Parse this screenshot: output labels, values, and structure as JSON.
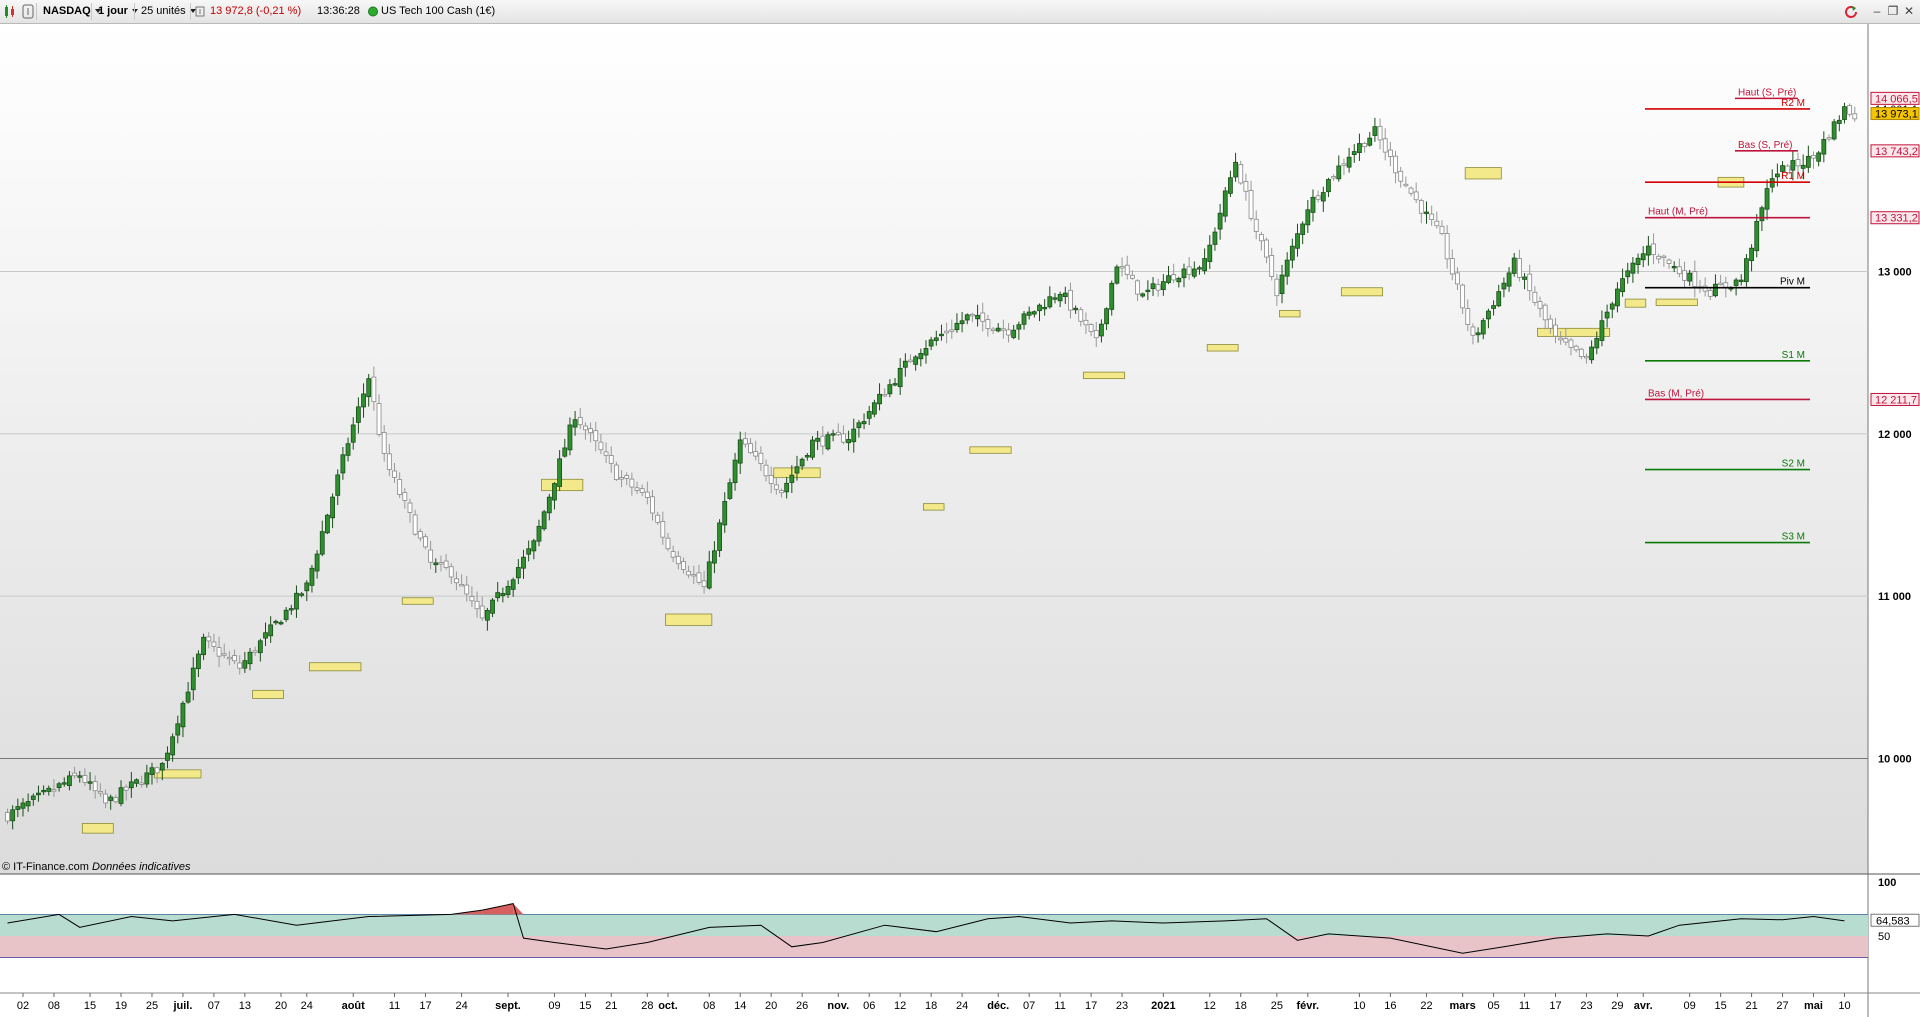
{
  "toolbar": {
    "symbol": "NASDAQ",
    "period": "1 jour",
    "units": "25 unités",
    "price_change": "13 972,8 (-0,21 %)",
    "time": "13:36:28",
    "instrument": "US Tech 100 Cash (1€)",
    "icons": [
      "chart-type-icon",
      "settings-icon",
      "info-icon",
      "status-dot-icon",
      "refresh-icon",
      "minimize-icon",
      "restore-icon",
      "close-icon"
    ],
    "colors": {
      "negative": "#c00000",
      "status_dot": "#2eaa2e"
    }
  },
  "copyright": {
    "left": "© IT-Finance.com",
    "right": "Données indicatives"
  },
  "chart_data": [
    {
      "type": "candlestick",
      "y_range": [
        9350,
        14500
      ],
      "y_ticks": [
        {
          "value": 10000,
          "label": "10 000"
        },
        {
          "value": 11000,
          "label": "11 000"
        },
        {
          "value": 12000,
          "label": "12 000"
        },
        {
          "value": 13000,
          "label": "13 000"
        }
      ],
      "price_labels": [
        {
          "value": 14066.5,
          "label": "14 066,5",
          "style": "red"
        },
        {
          "value": 14001.1,
          "label": "14 001,1",
          "style": "plain"
        },
        {
          "value": 13973.1,
          "label": "13 973,1",
          "style": "last"
        },
        {
          "value": 13743.2,
          "label": "13 743,2",
          "style": "red"
        },
        {
          "value": 13331.2,
          "label": "13 331,2",
          "style": "red"
        },
        {
          "value": 12211.7,
          "label": "12 211,7",
          "style": "red"
        }
      ],
      "trend": [
        [
          0,
          9650
        ],
        [
          14,
          9900
        ],
        [
          19,
          9720
        ],
        [
          30,
          9960
        ],
        [
          38,
          10720
        ],
        [
          45,
          10560
        ],
        [
          58,
          11060
        ],
        [
          66,
          11950
        ],
        [
          70,
          12350
        ],
        [
          73,
          11850
        ],
        [
          82,
          11200
        ],
        [
          86,
          11150
        ],
        [
          92,
          10850
        ],
        [
          102,
          11320
        ],
        [
          110,
          12120
        ],
        [
          118,
          11750
        ],
        [
          124,
          11600
        ],
        [
          128,
          11300
        ],
        [
          135,
          11050
        ],
        [
          142,
          11950
        ],
        [
          150,
          11650
        ],
        [
          156,
          11950
        ],
        [
          163,
          11980
        ],
        [
          176,
          12500
        ],
        [
          186,
          12720
        ],
        [
          194,
          12640
        ],
        [
          204,
          12880
        ],
        [
          211,
          12560
        ],
        [
          215,
          13050
        ],
        [
          220,
          12850
        ],
        [
          226,
          12980
        ],
        [
          232,
          13050
        ],
        [
          238,
          13680
        ],
        [
          242,
          13250
        ],
        [
          246,
          12880
        ],
        [
          252,
          13400
        ],
        [
          260,
          13720
        ],
        [
          265,
          13860
        ],
        [
          270,
          13580
        ],
        [
          278,
          13200
        ],
        [
          284,
          12580
        ],
        [
          292,
          13050
        ],
        [
          300,
          12580
        ],
        [
          306,
          12450
        ],
        [
          312,
          12900
        ],
        [
          318,
          13150
        ],
        [
          324,
          13000
        ],
        [
          330,
          12880
        ],
        [
          336,
          12950
        ],
        [
          342,
          13600
        ],
        [
          350,
          13700
        ],
        [
          356,
          14000
        ],
        [
          358,
          13973
        ]
      ],
      "levels": [
        {
          "name": "Haut (S, Pré)",
          "value": 14066.5,
          "color": "#c0143c",
          "scope": "week"
        },
        {
          "name": "R2 M",
          "value": 14001.1,
          "color": "#d40000",
          "scope": "month"
        },
        {
          "name": "Bas (S, Pré)",
          "value": 13743.2,
          "color": "#c0143c",
          "scope": "week"
        },
        {
          "name": "R1 M",
          "value": 13550,
          "color": "#d40000",
          "scope": "month"
        },
        {
          "name": "Haut (M, Pré)",
          "value": 13331.2,
          "color": "#c0143c",
          "scope": "month"
        },
        {
          "name": "Piv M",
          "value": 12900,
          "color": "#000000",
          "scope": "month"
        },
        {
          "name": "S1 M",
          "value": 12450,
          "color": "#0a7a0a",
          "scope": "month"
        },
        {
          "name": "Bas (M, Pré)",
          "value": 12211.7,
          "color": "#c0143c",
          "scope": "month"
        },
        {
          "name": "S2 M",
          "value": 11780,
          "color": "#0a7a0a",
          "scope": "month"
        },
        {
          "name": "S3 M",
          "value": 11330,
          "color": "#0a7a0a",
          "scope": "month"
        }
      ],
      "gap_boxes": [
        {
          "x0": 14.5,
          "x1": 20.5,
          "low": 9540,
          "high": 9600
        },
        {
          "x0": 28.5,
          "x1": 37.5,
          "low": 9880,
          "high": 9930
        },
        {
          "x0": 47.5,
          "x1": 53.5,
          "low": 10370,
          "high": 10420
        },
        {
          "x0": 58.5,
          "x1": 68.5,
          "low": 10540,
          "high": 10590
        },
        {
          "x0": 76.5,
          "x1": 82.5,
          "low": 10950,
          "high": 10990
        },
        {
          "x0": 103.5,
          "x1": 111.5,
          "low": 11650,
          "high": 11720
        },
        {
          "x0": 127.5,
          "x1": 136.5,
          "low": 10820,
          "high": 10890
        },
        {
          "x0": 148.5,
          "x1": 157.5,
          "low": 11730,
          "high": 11790
        },
        {
          "x0": 177.5,
          "x1": 181.5,
          "low": 11530,
          "high": 11570
        },
        {
          "x0": 186.5,
          "x1": 194.5,
          "low": 11880,
          "high": 11920
        },
        {
          "x0": 208.5,
          "x1": 216.5,
          "low": 12340,
          "high": 12380
        },
        {
          "x0": 232.5,
          "x1": 238.5,
          "low": 12510,
          "high": 12550
        },
        {
          "x0": 246.5,
          "x1": 250.5,
          "low": 12720,
          "high": 12760
        },
        {
          "x0": 258.5,
          "x1": 266.5,
          "low": 12850,
          "high": 12900
        },
        {
          "x0": 282.5,
          "x1": 289.5,
          "low": 13570,
          "high": 13640
        },
        {
          "x0": 296.5,
          "x1": 310.5,
          "low": 12600,
          "high": 12650
        },
        {
          "x0": 313.5,
          "x1": 317.5,
          "low": 12780,
          "high": 12830
        },
        {
          "x0": 319.5,
          "x1": 327.5,
          "low": 12790,
          "high": 12830
        },
        {
          "x0": 331.5,
          "x1": 336.5,
          "low": 13520,
          "high": 13580
        }
      ],
      "x_ticks": [
        {
          "i": 3,
          "label": "02",
          "major": false
        },
        {
          "i": 9,
          "label": "08",
          "major": false
        },
        {
          "i": 16,
          "label": "15",
          "major": false
        },
        {
          "i": 22,
          "label": "19",
          "major": false
        },
        {
          "i": 28,
          "label": "25",
          "major": false
        },
        {
          "i": 34,
          "label": "juil.",
          "major": true
        },
        {
          "i": 40,
          "label": "07",
          "major": false
        },
        {
          "i": 46,
          "label": "13",
          "major": false
        },
        {
          "i": 53,
          "label": "20",
          "major": false
        },
        {
          "i": 58,
          "label": "24",
          "major": false
        },
        {
          "i": 67,
          "label": "août",
          "major": true
        },
        {
          "i": 75,
          "label": "11",
          "major": false
        },
        {
          "i": 81,
          "label": "17",
          "major": false
        },
        {
          "i": 88,
          "label": "24",
          "major": false
        },
        {
          "i": 97,
          "label": "sept.",
          "major": true
        },
        {
          "i": 106,
          "label": "09",
          "major": false
        },
        {
          "i": 112,
          "label": "15",
          "major": false
        },
        {
          "i": 117,
          "label": "21",
          "major": false
        },
        {
          "i": 124,
          "label": "28",
          "major": false
        },
        {
          "i": 128,
          "label": "oct.",
          "major": true
        },
        {
          "i": 136,
          "label": "08",
          "major": false
        },
        {
          "i": 142,
          "label": "14",
          "major": false
        },
        {
          "i": 148,
          "label": "20",
          "major": false
        },
        {
          "i": 154,
          "label": "26",
          "major": false
        },
        {
          "i": 161,
          "label": "nov.",
          "major": true
        },
        {
          "i": 167,
          "label": "06",
          "major": false
        },
        {
          "i": 173,
          "label": "12",
          "major": false
        },
        {
          "i": 179,
          "label": "18",
          "major": false
        },
        {
          "i": 185,
          "label": "24",
          "major": false
        },
        {
          "i": 192,
          "label": "déc.",
          "major": true
        },
        {
          "i": 198,
          "label": "07",
          "major": false
        },
        {
          "i": 204,
          "label": "11",
          "major": false
        },
        {
          "i": 210,
          "label": "17",
          "major": false
        },
        {
          "i": 216,
          "label": "23",
          "major": false
        },
        {
          "i": 224,
          "label": "2021",
          "major": true
        },
        {
          "i": 233,
          "label": "12",
          "major": false
        },
        {
          "i": 239,
          "label": "18",
          "major": false
        },
        {
          "i": 246,
          "label": "25",
          "major": false
        },
        {
          "i": 252,
          "label": "févr.",
          "major": true
        },
        {
          "i": 262,
          "label": "10",
          "major": false
        },
        {
          "i": 268,
          "label": "16",
          "major": false
        },
        {
          "i": 275,
          "label": "22",
          "major": false
        },
        {
          "i": 282,
          "label": "mars",
          "major": true
        },
        {
          "i": 288,
          "label": "05",
          "major": false
        },
        {
          "i": 294,
          "label": "11",
          "major": false
        },
        {
          "i": 300,
          "label": "17",
          "major": false
        },
        {
          "i": 306,
          "label": "23",
          "major": false
        },
        {
          "i": 312,
          "label": "29",
          "major": false
        },
        {
          "i": 317,
          "label": "avr.",
          "major": true
        },
        {
          "i": 326,
          "label": "09",
          "major": false
        },
        {
          "i": 332,
          "label": "15",
          "major": false
        },
        {
          "i": 338,
          "label": "21",
          "major": false
        },
        {
          "i": 344,
          "label": "27",
          "major": false
        },
        {
          "i": 350,
          "label": "mai",
          "major": true
        },
        {
          "i": 356,
          "label": "10",
          "major": false
        }
      ]
    },
    {
      "type": "line",
      "name": "RSI",
      "y_range": [
        0,
        100
      ],
      "bands": {
        "upper": 70,
        "mid": 50,
        "lower": 30
      },
      "y_ticks": [
        {
          "value": 100,
          "label": "100"
        },
        {
          "value": 50,
          "label": "50"
        }
      ],
      "last_value": {
        "value": 64.583,
        "label": "64,583"
      },
      "points": [
        [
          0,
          62
        ],
        [
          10,
          70
        ],
        [
          14,
          58
        ],
        [
          24,
          68
        ],
        [
          32,
          64
        ],
        [
          44,
          70
        ],
        [
          56,
          60
        ],
        [
          70,
          68
        ],
        [
          86,
          70
        ],
        [
          92,
          74
        ],
        [
          98,
          80
        ],
        [
          100,
          48
        ],
        [
          106,
          44
        ],
        [
          116,
          38
        ],
        [
          124,
          44
        ],
        [
          136,
          58
        ],
        [
          146,
          60
        ],
        [
          152,
          40
        ],
        [
          158,
          44
        ],
        [
          170,
          60
        ],
        [
          180,
          54
        ],
        [
          190,
          66
        ],
        [
          196,
          68
        ],
        [
          206,
          62
        ],
        [
          214,
          64
        ],
        [
          224,
          62
        ],
        [
          236,
          64
        ],
        [
          244,
          66
        ],
        [
          250,
          46
        ],
        [
          256,
          52
        ],
        [
          268,
          48
        ],
        [
          276,
          40
        ],
        [
          282,
          34
        ],
        [
          290,
          40
        ],
        [
          300,
          48
        ],
        [
          310,
          52
        ],
        [
          318,
          50
        ],
        [
          324,
          60
        ],
        [
          336,
          66
        ],
        [
          344,
          65
        ],
        [
          350,
          68
        ],
        [
          356,
          64
        ]
      ],
      "colors": {
        "overbought": "#d66060",
        "neutral_top": "#b8dcd0",
        "neutral_bottom": "#e8c4c8",
        "line": "#000000"
      }
    }
  ]
}
